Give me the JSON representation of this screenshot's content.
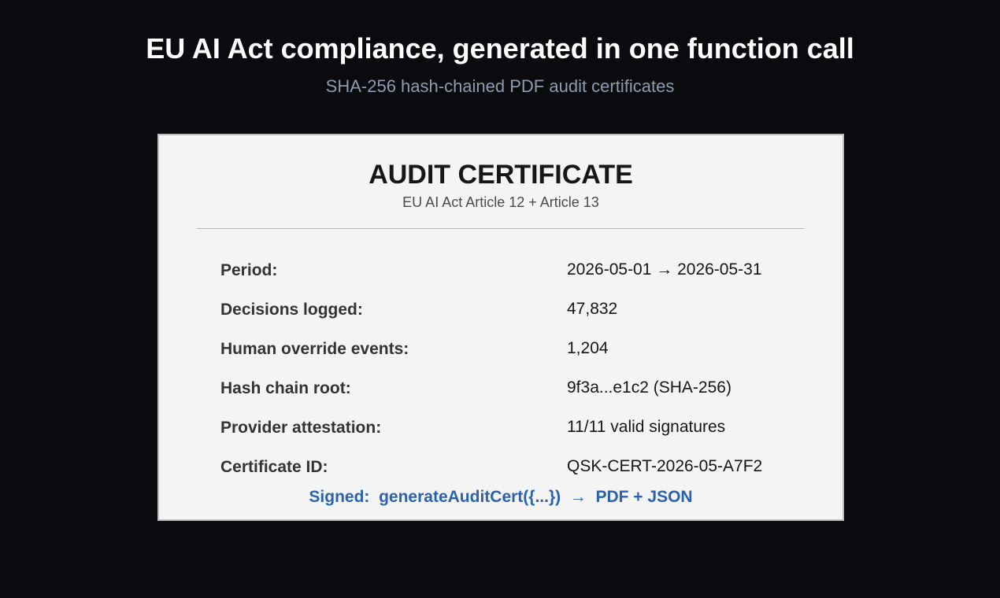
{
  "header": {
    "title": "EU AI Act compliance, generated in one function call",
    "subtitle": "SHA-256 hash-chained PDF audit certificates"
  },
  "certificate": {
    "title": "AUDIT CERTIFICATE",
    "subtitle": "EU AI Act Article 12 + Article 13",
    "rows": [
      {
        "label": "Period:",
        "value": "2026-05-01 → 2026-05-31"
      },
      {
        "label": "Decisions logged:",
        "value": "47,832"
      },
      {
        "label": "Human override events:",
        "value": "1,204"
      },
      {
        "label": "Hash chain root:",
        "value": "9f3a...e1c2 (SHA-256)"
      },
      {
        "label": "Provider attestation:",
        "value": "11/11 valid signatures"
      },
      {
        "label": "Certificate ID:",
        "value": "QSK-CERT-2026-05-A7F2"
      }
    ],
    "signed_line": "Signed:  generateAuditCert({...})  →  PDF + JSON"
  },
  "colors": {
    "background": "#0b0b0f",
    "card": "#f4f4f4",
    "accent": "#2a62ad",
    "subtitle": "#8f9bb0"
  }
}
